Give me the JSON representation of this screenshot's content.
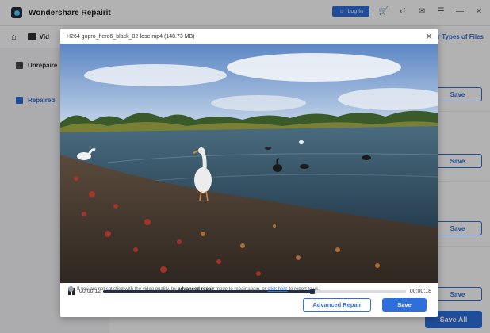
{
  "app": {
    "title": "Wondershare Repairit"
  },
  "titlebar": {
    "login_label": "Log In"
  },
  "nav": {
    "video_tab": "Vid",
    "other_types": "her Types of Files"
  },
  "sidebar": {
    "items": [
      {
        "label": "Unrepaire"
      },
      {
        "label": "Repaired"
      }
    ]
  },
  "main": {
    "save_label": "Save",
    "save_all_label": "Save All"
  },
  "modal": {
    "title": "H264 gopro_hero6_black_02-lose.mp4 (148.73  MB)",
    "time_current": "00:00:12",
    "time_total": "00:00:18",
    "progress": 0.69,
    "notice_pre": "If you are not satisfied with the video quality, try ",
    "notice_bold": "advanced repair",
    "notice_mid": " mode to repair again, or ",
    "notice_link": "click here",
    "notice_post": " to report to us.",
    "advanced_repair_label": "Advanced Repair",
    "save_label": "Save"
  },
  "colors": {
    "accent": "#2f6fdc",
    "cart": "#ff7a1a"
  },
  "icons": [
    "home-icon",
    "video-icon",
    "user-icon",
    "cart-icon",
    "headset-icon",
    "mail-icon",
    "menu-icon",
    "minimize-icon",
    "close-icon",
    "pause-icon",
    "info-icon"
  ]
}
